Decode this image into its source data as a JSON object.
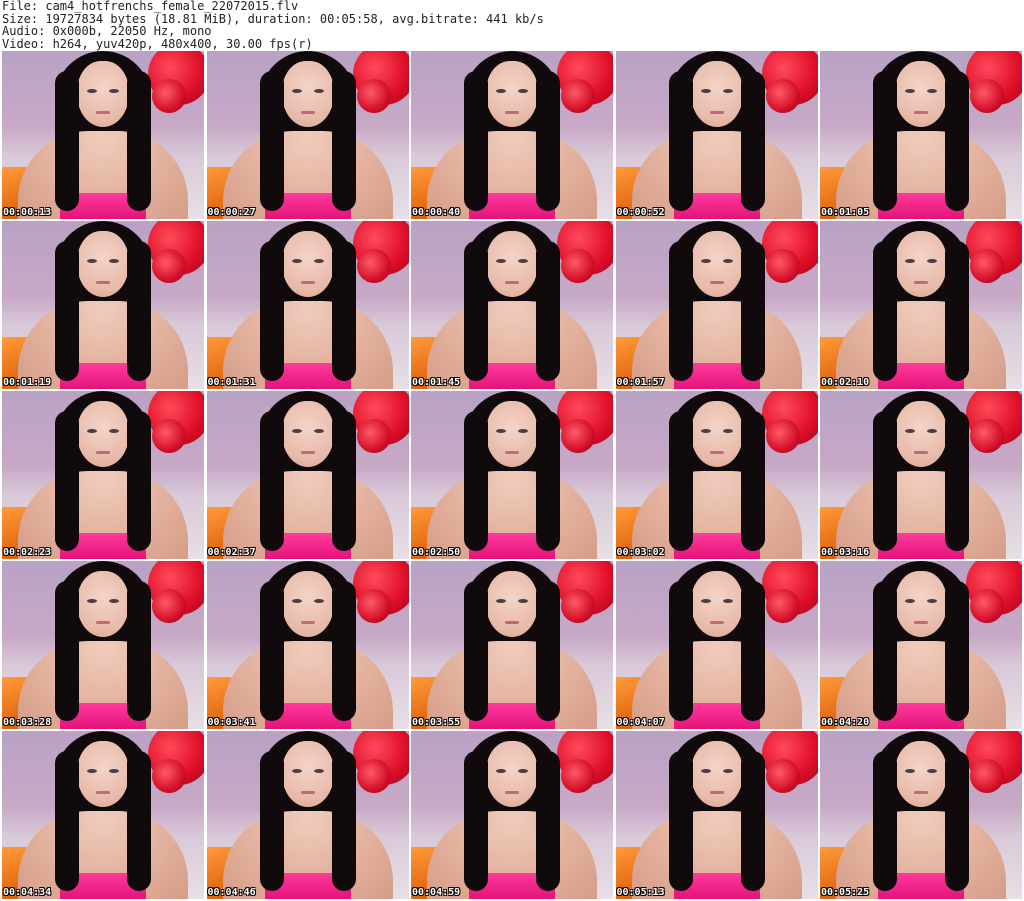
{
  "header": {
    "file_line": "File: cam4_hotfrenchs_female_22072015.flv",
    "size_line": "Size: 19727834 bytes (18.81 MiB), duration: 00:05:58, avg.bitrate: 441 kb/s",
    "audio_line": "Audio: 0x000b, 22050 Hz, mono",
    "video_line": "Video: h264, yuv420p, 480x400, 30.00 fps(r)"
  },
  "thumbnails": [
    {
      "timestamp": "00:00:13"
    },
    {
      "timestamp": "00:00:27"
    },
    {
      "timestamp": "00:00:40"
    },
    {
      "timestamp": "00:00:52"
    },
    {
      "timestamp": "00:01:05"
    },
    {
      "timestamp": "00:01:19"
    },
    {
      "timestamp": "00:01:31"
    },
    {
      "timestamp": "00:01:45"
    },
    {
      "timestamp": "00:01:57"
    },
    {
      "timestamp": "00:02:10"
    },
    {
      "timestamp": "00:02:23"
    },
    {
      "timestamp": "00:02:37"
    },
    {
      "timestamp": "00:02:50"
    },
    {
      "timestamp": "00:03:02"
    },
    {
      "timestamp": "00:03:16"
    },
    {
      "timestamp": "00:03:28"
    },
    {
      "timestamp": "00:03:41"
    },
    {
      "timestamp": "00:03:55"
    },
    {
      "timestamp": "00:04:07"
    },
    {
      "timestamp": "00:04:20"
    },
    {
      "timestamp": "00:04:34"
    },
    {
      "timestamp": "00:04:46"
    },
    {
      "timestamp": "00:04:59"
    },
    {
      "timestamp": "00:05:13"
    },
    {
      "timestamp": "00:05:25"
    }
  ]
}
